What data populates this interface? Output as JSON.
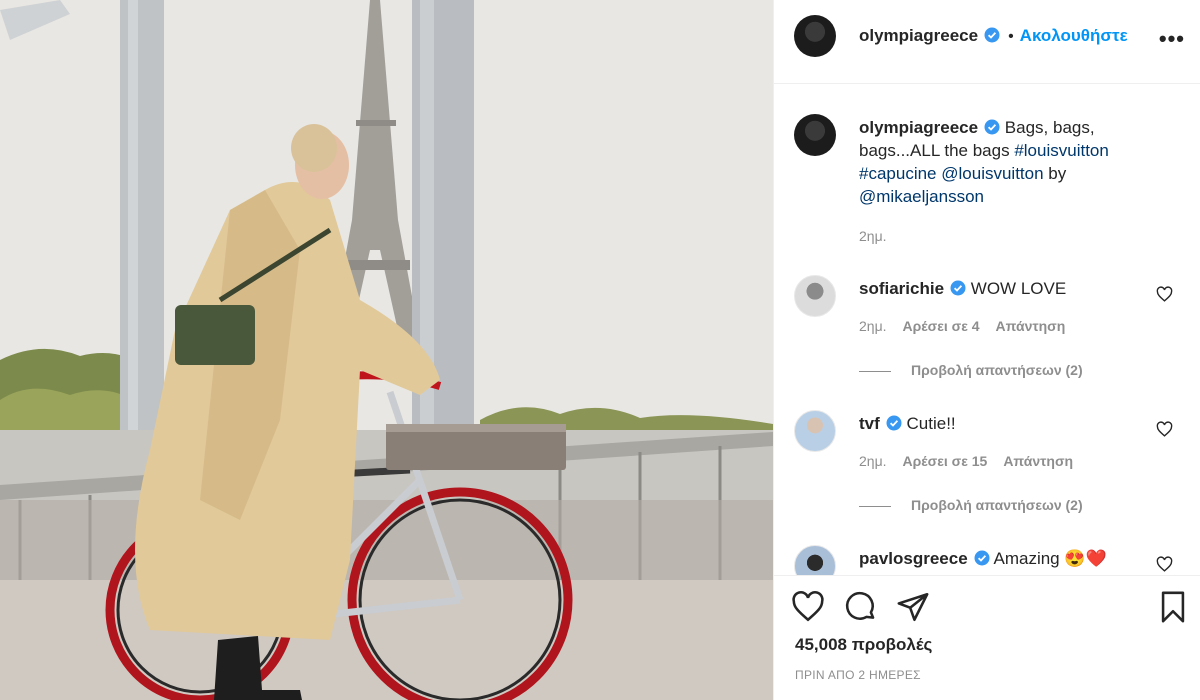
{
  "post": {
    "author": "olympiagreece",
    "follow_label": "Ακολουθήστε",
    "dot": "•",
    "more_label": "•••"
  },
  "caption": {
    "author": "olympiagreece",
    "text_1": "Bags, bags, bags...ALL the bags",
    "hashtag_1": "#louisvuitton",
    "hashtag_2": "#capucine",
    "mention_1": "@louisvuitton",
    "by": "by",
    "mention_2": "@mikaeljansson",
    "time": "2ημ."
  },
  "comments": [
    {
      "user": "sofiarichie",
      "text": "WOW LOVE",
      "time": "2ημ.",
      "likes": "Αρέσει σε 4",
      "reply": "Απάντηση",
      "view_replies": "Προβολή απαντήσεων (2)"
    },
    {
      "user": "tvf",
      "text": "Cutie!!",
      "time": "2ημ.",
      "likes": "Αρέσει σε 15",
      "reply": "Απάντηση",
      "view_replies": "Προβολή απαντήσεων (2)"
    },
    {
      "user": "pavlosgreece",
      "text": "Amazing",
      "emoji": "😍❤️"
    }
  ],
  "stats": {
    "views": "45,008 προβολές",
    "posted": "ΠΡΙΝ ΑΠΟ 2 ΗΜΕΡΕΣ"
  },
  "icons": {
    "like": "heart-icon",
    "comment": "comment-icon",
    "share": "share-icon",
    "save": "bookmark-icon",
    "verified": "verified-badge-icon"
  },
  "colors": {
    "link_blue": "#0095f6",
    "hashtag_blue": "#00376b",
    "verified_blue": "#3897f0",
    "muted": "#8e8e8e"
  }
}
